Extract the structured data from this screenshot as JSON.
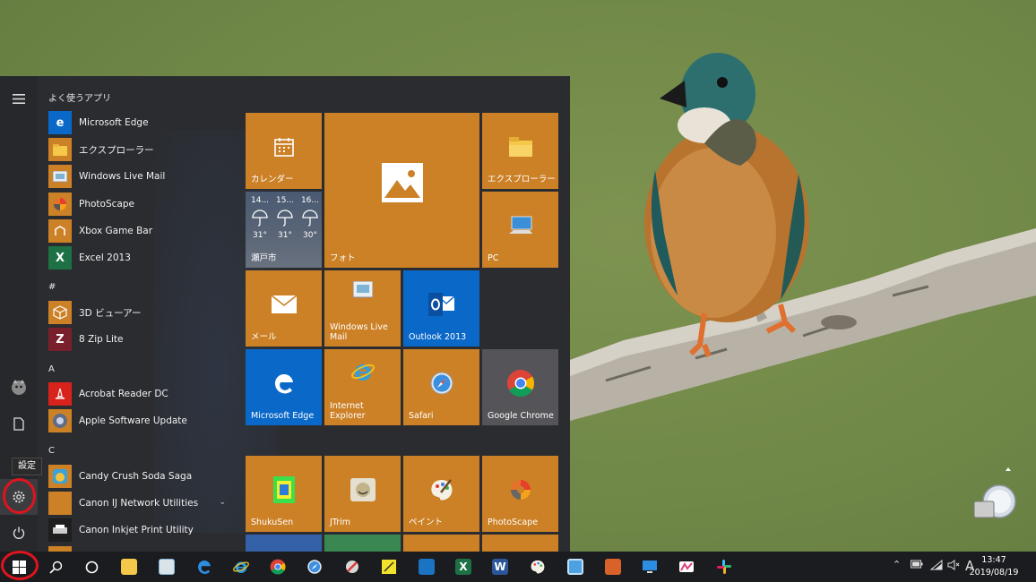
{
  "start_menu": {
    "header": "よく使うアプリ",
    "sections": {
      "hash": "#",
      "a": "A",
      "c": "C"
    },
    "apps": [
      {
        "label": "Microsoft Edge"
      },
      {
        "label": "エクスプローラー"
      },
      {
        "label": "Windows Live Mail"
      },
      {
        "label": "PhotoScape"
      },
      {
        "label": "Xbox Game Bar"
      },
      {
        "label": "Excel 2013"
      },
      {
        "label": "3D ビューアー"
      },
      {
        "label": "8 Zip Lite"
      },
      {
        "label": "Acrobat Reader DC"
      },
      {
        "label": "Apple Software Update"
      },
      {
        "label": "Candy Crush Soda Saga"
      },
      {
        "label": "Canon IJ Network Utilities"
      },
      {
        "label": "Canon Inkjet Print Utility"
      }
    ],
    "tooltip": "設定"
  },
  "tiles": {
    "calendar": "カレンダー",
    "photos": "フォト",
    "explorer": "エクスプローラー",
    "pc": "PC",
    "weather": {
      "location": "瀬戸市",
      "days": [
        "14...",
        "15...",
        "16..."
      ],
      "temps": [
        "31°",
        "31°",
        "30°"
      ]
    },
    "mail": "メール",
    "windows_live_mail": "Windows Live Mail",
    "outlook": "Outlook 2013",
    "edge": "Microsoft Edge",
    "ie": "Internet Explorer",
    "safari": "Safari",
    "chrome": "Google Chrome",
    "shukusen": "ShukuSen",
    "jtrim": "JTrim",
    "paint": "ペイント",
    "photoscape": "PhotoScape"
  },
  "taskbar": {
    "clock_time": "13:47",
    "clock_date": "2019/08/19",
    "ime": "A"
  },
  "colors": {
    "tile_orange": "#cc8127",
    "tile_blue": "#0a68c8",
    "start_bg": "#2a2c30",
    "taskbar_bg": "#1b1c1f",
    "marker_red": "#e0141e"
  }
}
